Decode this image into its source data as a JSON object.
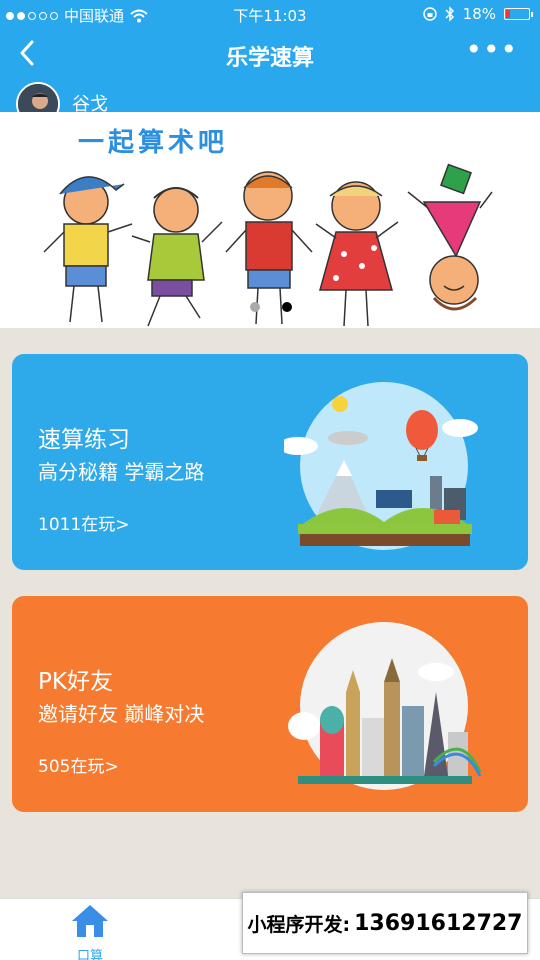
{
  "status_bar": {
    "carrier": "中国联通",
    "time": "下午11:03",
    "battery": "18%",
    "signal_dots_filled": 2,
    "signal_dots_total": 5
  },
  "nav": {
    "title": "乐学速算",
    "more": "•••"
  },
  "user": {
    "name": "谷戈"
  },
  "banner": {
    "title": "一起算术吧",
    "indicator_count": 2,
    "active_index": 1
  },
  "cards": [
    {
      "title": "速算练习",
      "subtitle": "高分秘籍 学霸之路",
      "count": "1011在玩>",
      "color": "#2ea9ea"
    },
    {
      "title": "PK好友",
      "subtitle": "邀请好友 巅峰对决",
      "count": "505在玩>",
      "color": "#f67a2f"
    }
  ],
  "tabbar": {
    "tabs": [
      {
        "label": "口算",
        "icon": "home-icon"
      }
    ]
  },
  "ad": {
    "label": "小程序开发:",
    "phone": "13691612727"
  },
  "colors": {
    "primary": "#29a8ee",
    "background": "#e8e4dc",
    "card_blue": "#2ea9ea",
    "card_orange": "#f67a2f"
  }
}
